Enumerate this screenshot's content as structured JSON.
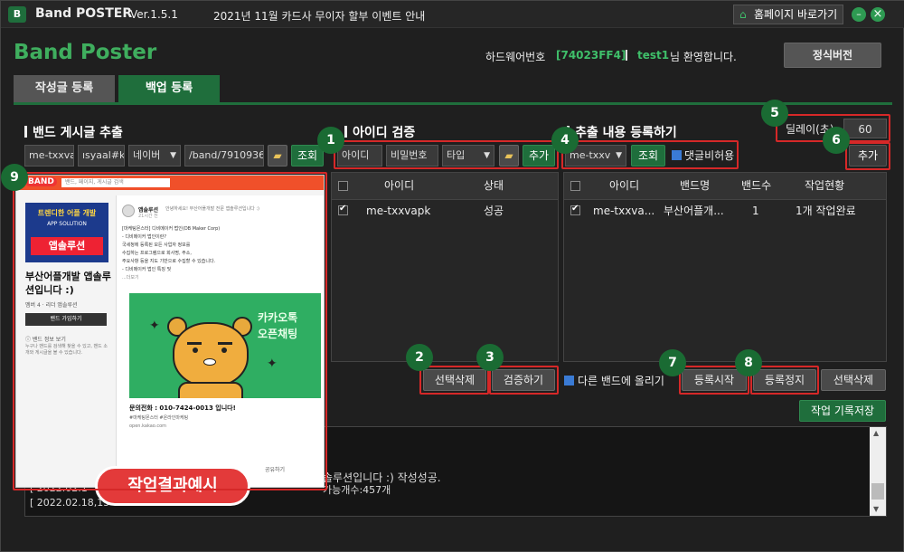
{
  "titlebar": {
    "app_logo_letter": "B",
    "app_name": "Band POSTER",
    "version": "Ver.1.5.1",
    "notice": "2021년 11월 카드사 무이자 할부 이벤트 안내",
    "home_button": "홈페이지 바로가기",
    "minimize": "–",
    "close": "×"
  },
  "header": {
    "brand": "Band Poster",
    "hw_label": "하드웨어번호",
    "hw_value": "[74023FF4]",
    "user_id": "test1",
    "welcome": "님 환영합니다.",
    "license_button": "정식버전"
  },
  "tabs": [
    {
      "label": "작성글 등록"
    },
    {
      "label": "백업 등록"
    }
  ],
  "extract": {
    "title": "밴드 게시글 추출",
    "id_field": "me-txxvapk",
    "pw_field": "ısyaal#kr",
    "engine": "네이버",
    "url": "/band/79109369",
    "search_button": "조회"
  },
  "verify": {
    "title": "아이디 검증",
    "id_field": "아이디",
    "pw_field": "비밀번호",
    "type_field": "타입",
    "add_button": "추가",
    "headers": [
      "아이디",
      "상태"
    ],
    "rows": [
      {
        "id": "me-txxvapk",
        "status": "성공"
      }
    ],
    "delete_button": "선택삭제",
    "check_button": "검증하기"
  },
  "register": {
    "title": "추출 내용 등록하기",
    "account": "me-txxv",
    "search_button": "조회",
    "comment_label": "댓글비허용",
    "delay_label": "딜레이(초)",
    "delay_value": "60",
    "add_button": "추가",
    "headers": [
      "아이디",
      "밴드명",
      "밴드수",
      "작업현황"
    ],
    "rows": [
      {
        "id": "me-txxva...",
        "band": "부산어플개...",
        "count": "1",
        "status": "1개 작업완료"
      }
    ],
    "other_band_label": "다른 밴드에 올리기",
    "start_button": "등록시작",
    "stop_button": "등록정지",
    "delete_button": "선택삭제",
    "save_log_button": "작업 기록저장"
  },
  "log": {
    "lines": [
      "솔루션입니다 :) 작성성공.",
      "[ 2022.02.1",
      "[ 2022.02.18,15",
      "가능개수:457개"
    ]
  },
  "preview": {
    "brand": "BAND",
    "search_placeholder": "밴드, 페이지, 게시글 검색",
    "banner_line1": "트렌디한 어플 개발",
    "banner_line2": "APP SOLUTION",
    "banner_line3": "앱솔루션",
    "band_name": "부산어플개발 앱솔루션입니다 :)",
    "members": "멤버 4 · 리더 앱솔루션",
    "join_button": "밴드 가입하기",
    "band_info": "ⓘ 밴드 정보 보기",
    "band_desc": "누구나 밴드를 검색해 찾을 수 있고, 밴드 소개와 게시글을 볼 수 있습니다.",
    "post_author": "앱솔루션",
    "post_meta": "21시간 전",
    "post_tagline": "안녕하세요! 부산어플개발 전문 앱솔루션입니다 :)",
    "post_lines": [
      "[마케팅몬스터] 디비메이커 법인(DB Maker Corp)",
      "- 디비메이커 법인이란?",
      "국세청에 등록된 모든 사업자 정보를",
      "수집하는 프로그램으로 회사명, 주소,",
      "주요사항 등을 지도 기반으로 수집할 수 있습니다.",
      "- 디비메이커 법인 특징 및",
      "...더보기"
    ],
    "image_text1": "카카오톡",
    "image_text2": "오픈채팅",
    "phone": "문의전화 : 010-7424-0013 입니다!",
    "hashtags": "#마케팅몬스터 #온라인마케팅",
    "link": "open.kakao.com",
    "share": "공유하기",
    "caption": "작업결과예시"
  },
  "markers": [
    "1",
    "2",
    "3",
    "4",
    "5",
    "6",
    "7",
    "8",
    "9"
  ]
}
